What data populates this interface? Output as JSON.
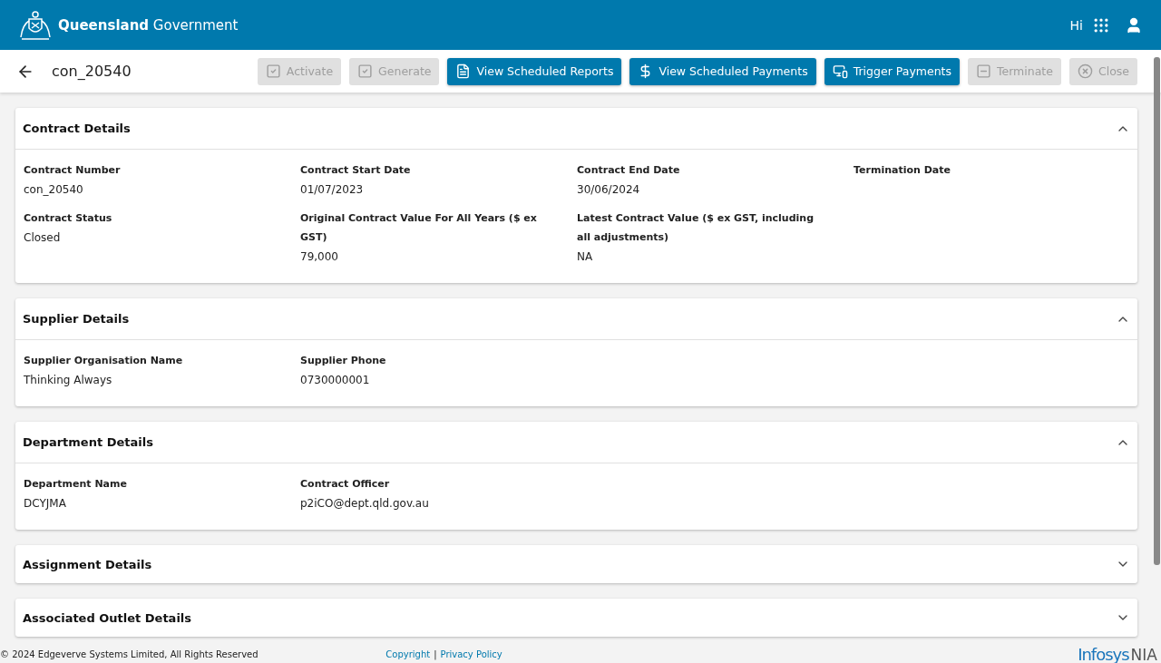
{
  "header": {
    "brand": "**Queensland** Government",
    "greeting": "Hi"
  },
  "toolbar": {
    "title": "con_20540",
    "buttons": [
      {
        "label": "Activate",
        "kind": "approve",
        "disabled": true
      },
      {
        "label": "Generate",
        "kind": "approve",
        "disabled": true
      },
      {
        "label": "View Scheduled Reports",
        "kind": "report",
        "disabled": false
      },
      {
        "label": "View Scheduled Payments",
        "kind": "dollar",
        "disabled": false
      },
      {
        "label": "Trigger Payments",
        "kind": "devices",
        "disabled": false
      },
      {
        "label": "Terminate",
        "kind": "minus",
        "disabled": true
      },
      {
        "label": "Close",
        "kind": "cancel",
        "disabled": true
      }
    ]
  },
  "sections": [
    {
      "title": "Contract Details",
      "expanded": true,
      "fields": [
        {
          "label": "Contract Number",
          "value": "con_20540"
        },
        {
          "label": "Contract Start Date",
          "value": "01/07/2023"
        },
        {
          "label": "Contract End Date",
          "value": "30/06/2024"
        },
        {
          "label": "Termination Date"
        },
        {
          "label": "Contract Status",
          "value": "Closed"
        },
        {
          "label": "Original Contract Value For All Years ($ ex GST)",
          "value": "79,000"
        },
        {
          "label": "Latest Contract Value ($ ex GST, including all adjustments)",
          "value": "NA"
        }
      ]
    },
    {
      "title": "Supplier Details",
      "expanded": true,
      "fields": [
        {
          "label": "Supplier Organisation Name",
          "value": "Thinking Always"
        },
        {
          "label": "Supplier Phone",
          "value": "0730000001"
        }
      ]
    },
    {
      "title": "Department Details",
      "expanded": true,
      "fields": [
        {
          "label": "Department Name",
          "value": "DCYJMA"
        },
        {
          "label": "Contract Officer",
          "value": "p2iCO@dept.qld.gov.au"
        }
      ]
    },
    {
      "title": "Assignment Details",
      "expanded": false
    },
    {
      "title": "Associated Outlet Details",
      "expanded": false
    }
  ],
  "footer": {
    "copyright": "© 2024 Edgeverve Systems Limited, All Rights Reserved",
    "links": [
      "Copyright",
      "Privacy Policy"
    ],
    "link_separator": "|",
    "logo": [
      "Infosys",
      "NIA"
    ]
  }
}
